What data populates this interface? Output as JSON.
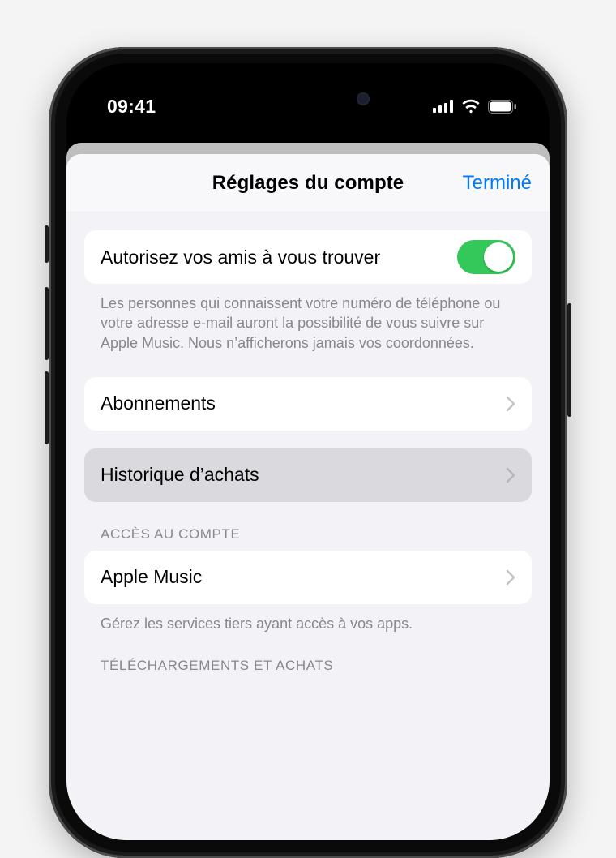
{
  "statusbar": {
    "time": "09:41"
  },
  "modal": {
    "title": "Réglages du compte",
    "done": "Terminé"
  },
  "friends": {
    "label": "Autorisez vos amis à vous trouver",
    "footnote": "Les personnes qui connaissent votre numéro de téléphone ou votre adresse e-mail auront la possibilité de vous suivre sur Apple Music. Nous n’afficherons jamais vos coordonnées."
  },
  "rows": {
    "subscriptions": "Abonnements",
    "purchase_history": "Historique d’achats",
    "apple_music": "Apple Music"
  },
  "sections": {
    "account_access": "ACCÈS AU COMPTE",
    "account_access_footnote": "Gérez les services tiers ayant accès à vos apps.",
    "downloads": "TÉLÉCHARGEMENTS ET ACHATS"
  }
}
